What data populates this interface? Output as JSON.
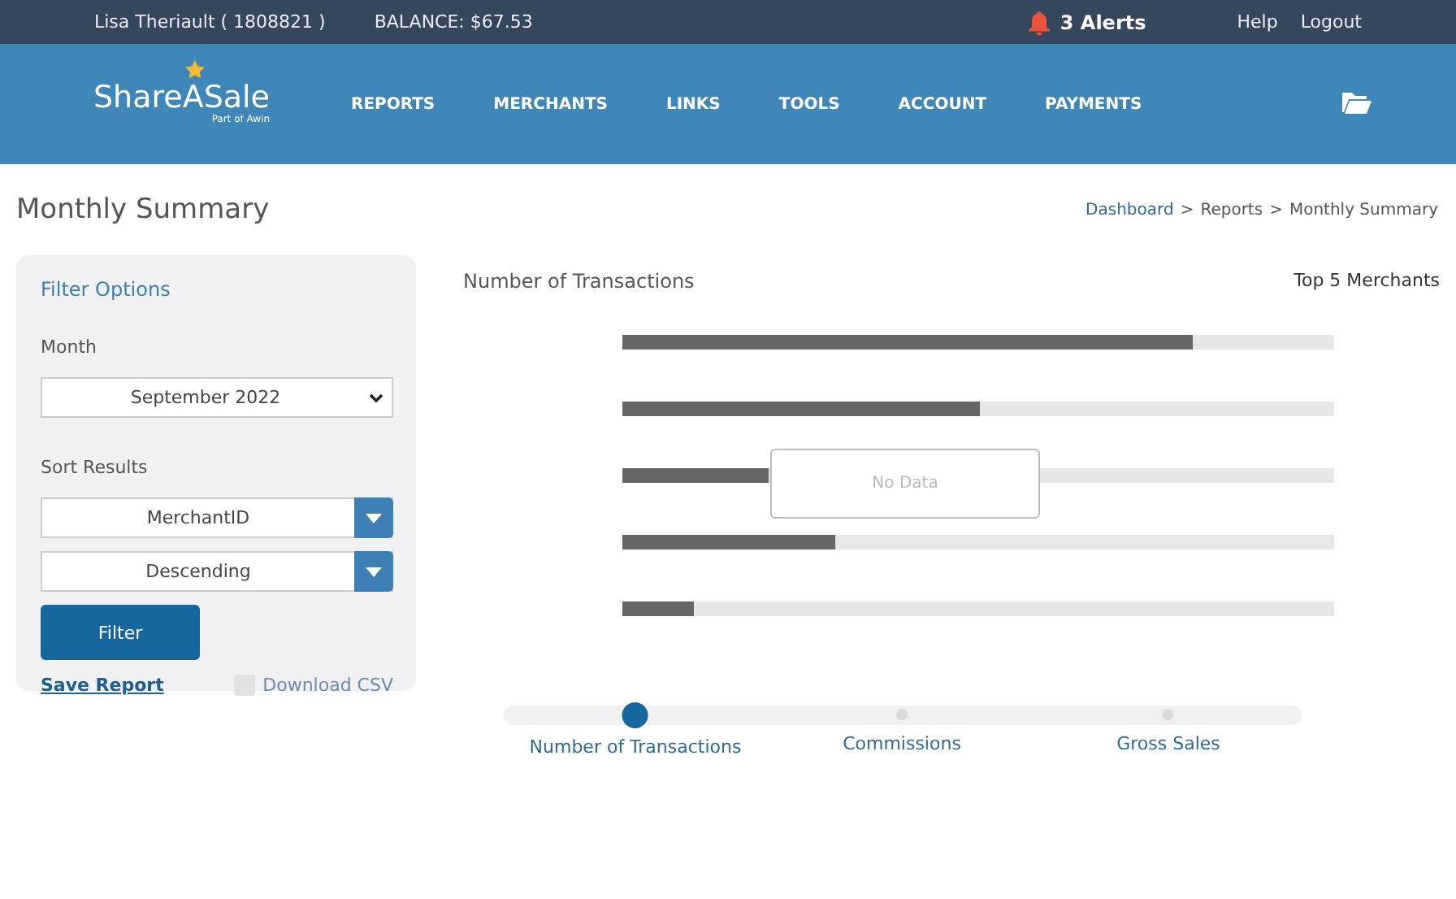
{
  "top_bar": {
    "user": "Lisa Theriault ( 1808821 )",
    "balance": "BALANCE: $67.53",
    "alerts": "3 Alerts",
    "links": [
      "Help",
      "Logout"
    ]
  },
  "header": {
    "logo": "ShareASale",
    "logo_sub": "Part of Awin",
    "nav": [
      "REPORTS",
      "MERCHANTS",
      "LINKS",
      "TOOLS",
      "ACCOUNT",
      "PAYMENTS"
    ]
  },
  "page_title": "Monthly Summary",
  "breadcrumb": [
    {
      "label": "Dashboard",
      "kind": "link"
    },
    {
      "label": ">",
      "kind": "sep"
    },
    {
      "label": "Reports",
      "kind": "text"
    },
    {
      "label": ">",
      "kind": "sep"
    },
    {
      "label": "Monthly Summary",
      "kind": "text"
    }
  ],
  "filter": {
    "title": "Filter Options",
    "month_label": "Month",
    "month": "September 2022",
    "sort_label": "Sort Results",
    "sort_by": "MerchantID",
    "order": "Descending",
    "button": "Filter",
    "save": "Save Report",
    "download": {
      "label": "Download CSV",
      "checked": false
    }
  },
  "chart": {
    "title": "Number of Transactions",
    "subtitle": "Top 5 Merchants",
    "empty": "No Data",
    "tabs": [
      {
        "label": "Number of Transactions",
        "selected": true
      },
      {
        "label": "Commissions",
        "selected": false
      },
      {
        "label": "Gross Sales",
        "selected": false
      }
    ]
  }
}
